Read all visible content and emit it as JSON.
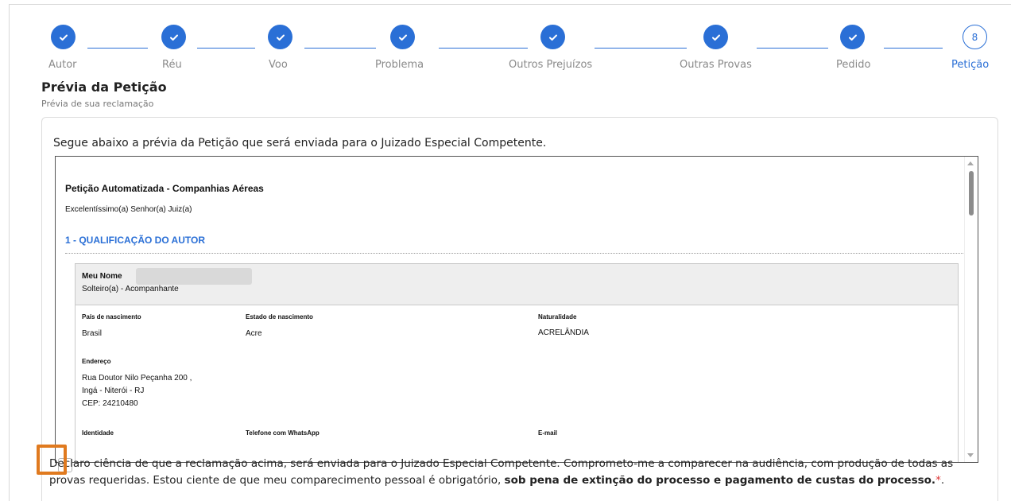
{
  "stepper": {
    "steps": [
      {
        "label": "Autor",
        "state": "done"
      },
      {
        "label": "Réu",
        "state": "done"
      },
      {
        "label": "Voo",
        "state": "done"
      },
      {
        "label": "Problema",
        "state": "done"
      },
      {
        "label": "Outros Prejuízos",
        "state": "done"
      },
      {
        "label": "Outras Provas",
        "state": "done"
      },
      {
        "label": "Pedido",
        "state": "done"
      },
      {
        "label": "Petição",
        "state": "current",
        "number": "8"
      }
    ]
  },
  "page": {
    "title": "Prévia da Petição",
    "subtitle": "Prévia de sua reclamação"
  },
  "card": {
    "intro": "Segue abaixo a prévia da Petição que será enviada para o Juizado Especial Competente."
  },
  "preview": {
    "doc_title": "Petição Automatizada - Companhias Aéreas",
    "salutation": "Excelentíssimo(a) Senhor(a) Juiz(a)",
    "section_title": "1 - QUALIFICAÇÃO DO AUTOR",
    "qualification": {
      "name_label": "Meu Nome",
      "civil_status": "Solteiro(a) - Acompanhante",
      "country_label": "País de nascimento",
      "country_value": "Brasil",
      "state_label": "Estado de nascimento",
      "state_value": "Acre",
      "naturality_label": "Naturalidade",
      "naturality_value": "ACRELÂNDIA",
      "address_label": "Endereço",
      "address_line1": "Rua Doutor Nilo Peçanha 200 ,",
      "address_line2": "Ingá - Niterói - RJ",
      "address_line3": "CEP: 24210480",
      "identity_label": "Identidade",
      "phone_label": "Telefone com WhatsApp",
      "email_label": "E-mail"
    }
  },
  "declaration": {
    "text_start": "Declaro ciência de que a reclamação acima, será enviada para o Juizado Especial Competente. Comprometo-me a comparecer na audiência, com produção de todas as provas requeridas. Estou ciente de que meu comparecimento pessoal é obrigatório, ",
    "text_bold": "sob pena de extinção do processo e pagamento de custas do processo.",
    "required_mark": "*",
    "text_end": ".",
    "checked": false
  },
  "colors": {
    "accent": "#2a6fd6",
    "highlight": "#e07a1f",
    "required": "#dd3333"
  }
}
